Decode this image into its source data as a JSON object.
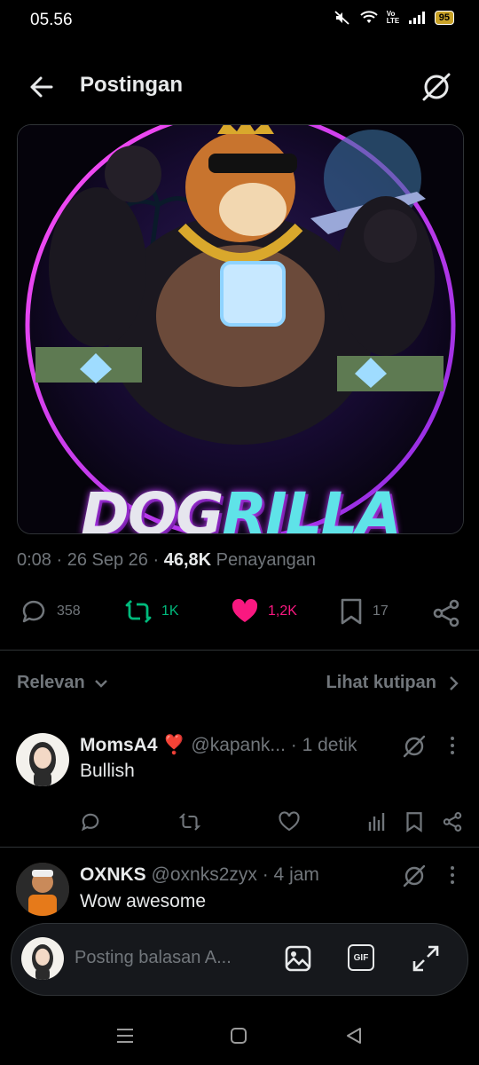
{
  "status_bar": {
    "time": "05.56",
    "battery": "95",
    "volte": "Vo LTE"
  },
  "header": {
    "title": "Postingan",
    "back_icon": "arrow-left-icon",
    "grok_icon": "grok-icon"
  },
  "media": {
    "title_part1": "DOG",
    "title_part2": "RILLA"
  },
  "post_meta": {
    "time": "0:08",
    "date": "26 Sep 26",
    "views": "46,8K",
    "views_label": "Penayangan",
    "sep": "·"
  },
  "actions": {
    "replies": "358",
    "reposts": "1K",
    "likes": "1,2K",
    "bookmarks": "17"
  },
  "colors": {
    "repost": "#00ba7c",
    "like": "#f91880",
    "muted": "#71767b",
    "text": "#e7e9ea"
  },
  "filter": {
    "sort_label": "Relevan",
    "quotes_label": "Lihat kutipan"
  },
  "replies": [
    {
      "name": "MomsA4",
      "emoji": "❣️",
      "handle": "@kapank...",
      "time": "· 1 detik",
      "text": "Bullish"
    },
    {
      "name": "OXNKS",
      "handle": "@oxnks2zyx",
      "time": "· 4 jam",
      "text": "Wow awesome"
    }
  ],
  "composer": {
    "placeholder": "Posting balasan A...",
    "gif_label": "GIF"
  }
}
